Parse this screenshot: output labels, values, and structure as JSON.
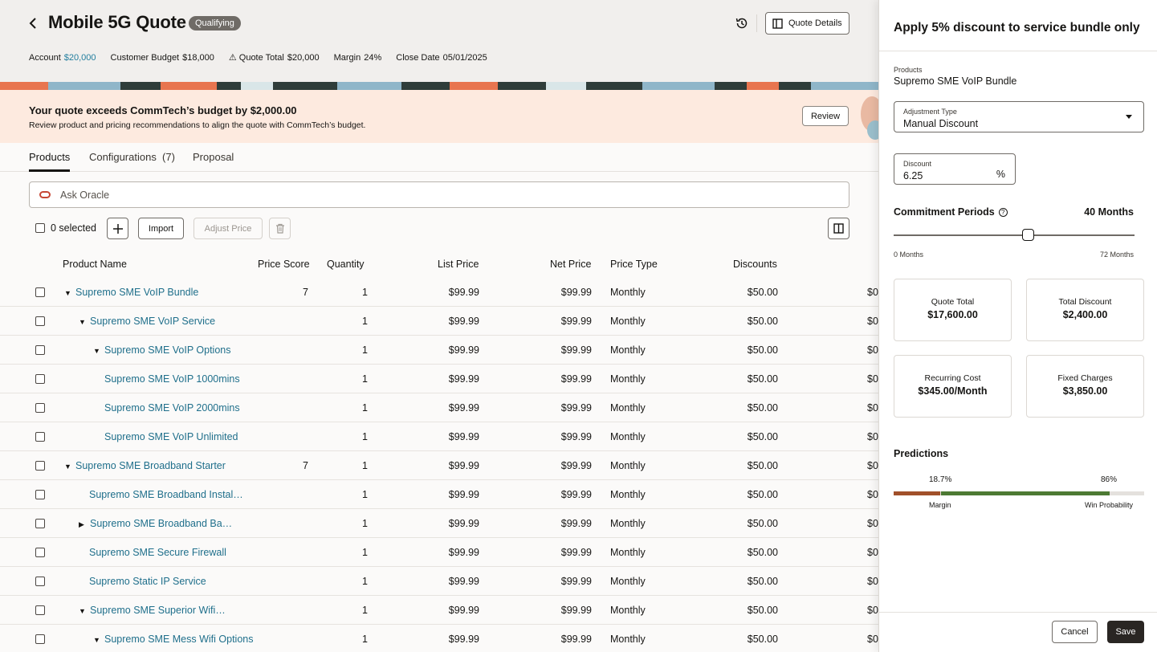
{
  "header": {
    "title": "Mobile 5G Quote",
    "status": "Qualifying",
    "quote_details_label": "Quote Details",
    "meta": {
      "account_label": "Account",
      "account_value": "$20,000",
      "budget_label": "Customer Budget",
      "budget_value": "$18,000",
      "quote_total_label": "Quote Total",
      "quote_total_value": "$20,000",
      "margin_label": "Margin",
      "margin_value": "24%",
      "close_label": "Close Date",
      "close_value": "05/01/2025"
    }
  },
  "alert": {
    "title": "Your quote exceeds CommTech’s budget by $2,000.00",
    "subtitle": "Review product and pricing recommendations to align the quote with CommTech’s budget.",
    "review_label": "Review"
  },
  "tabs": [
    {
      "label": "Products"
    },
    {
      "label": "Configurations  (7)"
    },
    {
      "label": "Proposal"
    }
  ],
  "ask": {
    "placeholder": "Ask Oracle"
  },
  "toolbar": {
    "selected_label": "0 selected",
    "import_label": "Import",
    "adjust_label": "Adjust Price"
  },
  "table": {
    "headers": {
      "name": "Product Name",
      "score": "Price Score",
      "qty": "Quantity",
      "list": "List Price",
      "net": "Net Price",
      "type": "Price Type",
      "disc": "Discounts",
      "extra": ""
    },
    "rows": [
      {
        "name": "Supremo SME VoIP Bundle",
        "level": 0,
        "caret": "▼",
        "score": "7",
        "qty": "1",
        "list": "$99.99",
        "net": "$99.99",
        "type": "Monthly",
        "disc": "$50.00",
        "extra": "$0"
      },
      {
        "name": "Supremo SME VoIP Service",
        "level": 1,
        "caret": "▼",
        "score": "",
        "qty": "1",
        "list": "$99.99",
        "net": "$99.99",
        "type": "Monthly",
        "disc": "$50.00",
        "extra": "$0"
      },
      {
        "name": "Supremo SME VoIP Options",
        "level": 2,
        "caret": "▼",
        "score": "",
        "qty": "1",
        "list": "$99.99",
        "net": "$99.99",
        "type": "Monthly",
        "disc": "$50.00",
        "extra": "$0"
      },
      {
        "name": "Supremo SME VoIP 1000mins",
        "level": 3,
        "caret": "",
        "score": "",
        "qty": "1",
        "list": "$99.99",
        "net": "$99.99",
        "type": "Monthly",
        "disc": "$50.00",
        "extra": "$0"
      },
      {
        "name": "Supremo SME VoIP 2000mins",
        "level": 3,
        "caret": "",
        "score": "",
        "qty": "1",
        "list": "$99.99",
        "net": "$99.99",
        "type": "Monthly",
        "disc": "$50.00",
        "extra": "$0"
      },
      {
        "name": "Supremo SME VoIP Unlimited",
        "level": 3,
        "caret": "",
        "score": "",
        "qty": "1",
        "list": "$99.99",
        "net": "$99.99",
        "type": "Monthly",
        "disc": "$50.00",
        "extra": "$0"
      },
      {
        "name": "Supremo SME Broadband Starter",
        "level": 0,
        "caret": "▼",
        "score": "7",
        "qty": "1",
        "list": "$99.99",
        "net": "$99.99",
        "type": "Monthly",
        "disc": "$50.00",
        "extra": "$0"
      },
      {
        "name": "Supremo SME Broadband Instal…",
        "level": 2,
        "caret": "",
        "score": "",
        "qty": "1",
        "list": "$99.99",
        "net": "$99.99",
        "type": "Monthly",
        "disc": "$50.00",
        "extra": "$0"
      },
      {
        "name": "Supremo SME Broadband Ba…",
        "level": 1,
        "caret": "▶",
        "score": "",
        "qty": "1",
        "list": "$99.99",
        "net": "$99.99",
        "type": "Monthly",
        "disc": "$50.00",
        "extra": "$0"
      },
      {
        "name": "Supremo SME Secure Firewall",
        "level": 2,
        "caret": "",
        "score": "",
        "qty": "1",
        "list": "$99.99",
        "net": "$99.99",
        "type": "Monthly",
        "disc": "$50.00",
        "extra": "$0"
      },
      {
        "name": "Supremo Static IP Service",
        "level": 2,
        "caret": "",
        "score": "",
        "qty": "1",
        "list": "$99.99",
        "net": "$99.99",
        "type": "Monthly",
        "disc": "$50.00",
        "extra": "$0"
      },
      {
        "name": "Supremo SME Superior Wifi…",
        "level": 1,
        "caret": "▼",
        "score": "",
        "qty": "1",
        "list": "$99.99",
        "net": "$99.99",
        "type": "Monthly",
        "disc": "$50.00",
        "extra": "$0"
      },
      {
        "name": "Supremo SME Mess Wifi Options",
        "level": 2,
        "caret": "▼",
        "score": "",
        "qty": "1",
        "list": "$99.99",
        "net": "$99.99",
        "type": "Monthly",
        "disc": "$50.00",
        "extra": "$0"
      }
    ]
  },
  "drawer": {
    "title": "Apply 5% discount to service bundle only",
    "products_label": "Products",
    "products_value": "Supremo SME VoIP Bundle",
    "adjustment_label": "Adjustment Type",
    "adjustment_value": "Manual Discount",
    "discount_label": "Discount",
    "discount_value": "6.25",
    "discount_unit": "%",
    "commitment_label": "Commitment Periods",
    "commitment_value": "40 Months",
    "commitment_months": 40,
    "slider_min_months": 0,
    "slider_max_months": 72,
    "slider_min": "0 Months",
    "slider_max": "72 Months",
    "cards": [
      {
        "label": "Quote Total",
        "value": "$17,600.00"
      },
      {
        "label": "Total Discount",
        "value": "$2,400.00"
      },
      {
        "label": "Recurring Cost",
        "value": "$345.00/Month"
      },
      {
        "label": "Fixed Charges",
        "value": "$3,850.00"
      }
    ],
    "predictions_title": "Predictions",
    "margin_pct": "18.7%",
    "margin_fraction": 0.187,
    "margin_label": "Margin",
    "win_pct": "86%",
    "win_fraction": 0.86,
    "win_label": "Win Probability",
    "cancel_label": "Cancel",
    "save_label": "Save"
  },
  "colors": {
    "link": "#1f6f8b",
    "alert_bg": "#fdeadf",
    "margin_bar": "#a1502a",
    "win_bar": "#4d7a33",
    "primary_button": "#2a2623"
  }
}
